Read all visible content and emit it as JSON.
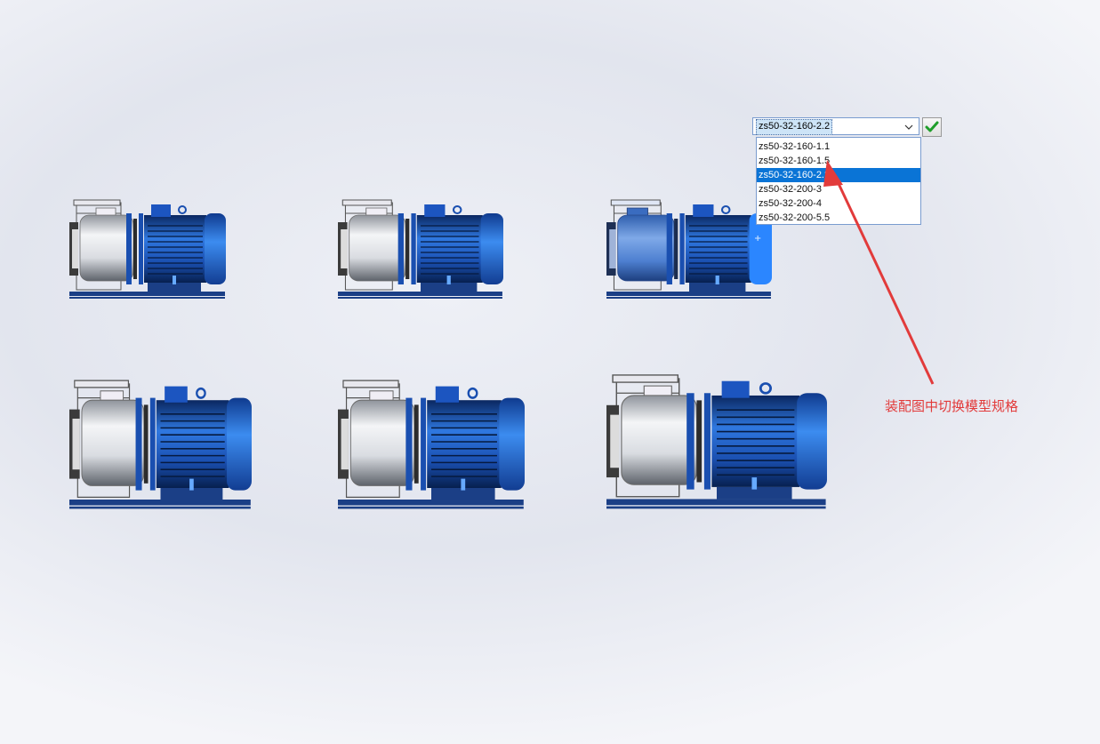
{
  "config_dropdown": {
    "selected_value": "zs50-32-160-2.2",
    "options": [
      {
        "label": "zs50-32-160-1.1",
        "selected": false
      },
      {
        "label": "zs50-32-160-1.5",
        "selected": false
      },
      {
        "label": "zs50-32-160-2.2",
        "selected": true
      },
      {
        "label": "zs50-32-200-3",
        "selected": false
      },
      {
        "label": "zs50-32-200-4",
        "selected": false
      },
      {
        "label": "zs50-32-200-5.5",
        "selected": false
      }
    ],
    "confirm_icon": "green-check-icon"
  },
  "annotation": {
    "text": "装配图中切换模型规格",
    "color": "#e23b3b"
  },
  "pumps": [
    {
      "name": "pump-model-1",
      "active": false
    },
    {
      "name": "pump-model-2",
      "active": false
    },
    {
      "name": "pump-model-3",
      "active": true
    },
    {
      "name": "pump-model-4",
      "active": false
    },
    {
      "name": "pump-model-5",
      "active": false
    },
    {
      "name": "pump-model-6",
      "active": false
    }
  ],
  "colors": {
    "motor_blue": "#1f5fc6",
    "base_navy": "#1b3f86",
    "selection_blue": "#0a74d6",
    "annotation_red": "#e23b3b"
  }
}
